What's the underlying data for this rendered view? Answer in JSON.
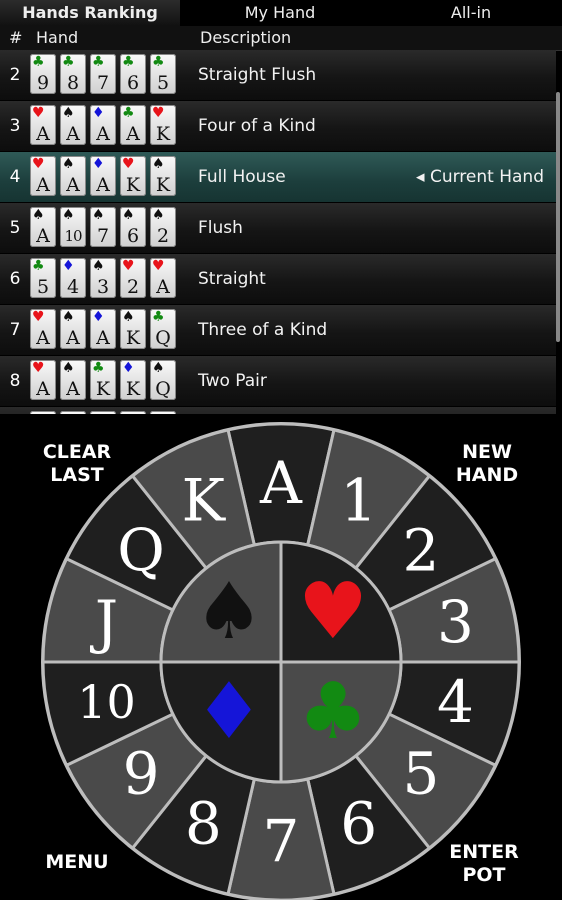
{
  "tabs": [
    "Hands Ranking",
    "My Hand",
    "All-in"
  ],
  "columns": {
    "num": "#",
    "hand": "Hand",
    "description": "Description"
  },
  "current_hand_label": "◂ Current Hand",
  "rows": [
    {
      "num": "2",
      "description": "Straight Flush",
      "cards": [
        [
          "♣",
          "9",
          "green"
        ],
        [
          "♣",
          "8",
          "green"
        ],
        [
          "♣",
          "7",
          "green"
        ],
        [
          "♣",
          "6",
          "green"
        ],
        [
          "♣",
          "5",
          "green"
        ]
      ]
    },
    {
      "num": "3",
      "description": "Four of a Kind",
      "cards": [
        [
          "♥",
          "A",
          "red"
        ],
        [
          "♠",
          "A",
          "black"
        ],
        [
          "♦",
          "A",
          "blue"
        ],
        [
          "♣",
          "A",
          "green"
        ],
        [
          "♥",
          "K",
          "red"
        ]
      ]
    },
    {
      "num": "4",
      "description": "Full House",
      "current": true,
      "cards": [
        [
          "♥",
          "A",
          "red"
        ],
        [
          "♠",
          "A",
          "black"
        ],
        [
          "♦",
          "A",
          "blue"
        ],
        [
          "♥",
          "K",
          "red"
        ],
        [
          "♠",
          "K",
          "black"
        ]
      ]
    },
    {
      "num": "5",
      "description": "Flush",
      "cards": [
        [
          "♠",
          "A",
          "black"
        ],
        [
          "♠",
          "10",
          "black"
        ],
        [
          "♠",
          "7",
          "black"
        ],
        [
          "♠",
          "6",
          "black"
        ],
        [
          "♠",
          "2",
          "black"
        ]
      ]
    },
    {
      "num": "6",
      "description": "Straight",
      "cards": [
        [
          "♣",
          "5",
          "green"
        ],
        [
          "♦",
          "4",
          "blue"
        ],
        [
          "♠",
          "3",
          "black"
        ],
        [
          "♥",
          "2",
          "red"
        ],
        [
          "♥",
          "A",
          "red"
        ]
      ]
    },
    {
      "num": "7",
      "description": "Three of a Kind",
      "cards": [
        [
          "♥",
          "A",
          "red"
        ],
        [
          "♠",
          "A",
          "black"
        ],
        [
          "♦",
          "A",
          "blue"
        ],
        [
          "♠",
          "K",
          "black"
        ],
        [
          "♣",
          "Q",
          "green"
        ]
      ]
    },
    {
      "num": "8",
      "description": "Two Pair",
      "cards": [
        [
          "♥",
          "A",
          "red"
        ],
        [
          "♠",
          "A",
          "black"
        ],
        [
          "♣",
          "K",
          "green"
        ],
        [
          "♦",
          "K",
          "blue"
        ],
        [
          "♠",
          "Q",
          "black"
        ]
      ]
    },
    {
      "num": "",
      "description": "",
      "cards": [
        [
          "",
          "",
          " "
        ],
        [
          "",
          "",
          " "
        ],
        [
          "",
          "",
          " "
        ],
        [
          "",
          "",
          " "
        ],
        [
          "",
          "",
          " "
        ]
      ]
    }
  ],
  "buttons": {
    "clear_last": "CLEAR\nLAST",
    "new_hand": "NEW\nHAND",
    "menu": "MENU",
    "enter_pot": "ENTER\nPOT"
  },
  "wheel": {
    "ranks": [
      "A",
      "1",
      "2",
      "3",
      "4",
      "5",
      "6",
      "7",
      "8",
      "9",
      "10",
      "J",
      "Q",
      "K"
    ],
    "suits": [
      "♠",
      "♥",
      "♦",
      "♣"
    ]
  },
  "colors": {
    "red": "#e8141b",
    "black": "#111111",
    "blue": "#1515d8",
    "green": "#128a12",
    "accent": "#1e3f3d",
    "wheel_light": "#4a4a4a",
    "wheel_dark": "#1f1f1f"
  }
}
